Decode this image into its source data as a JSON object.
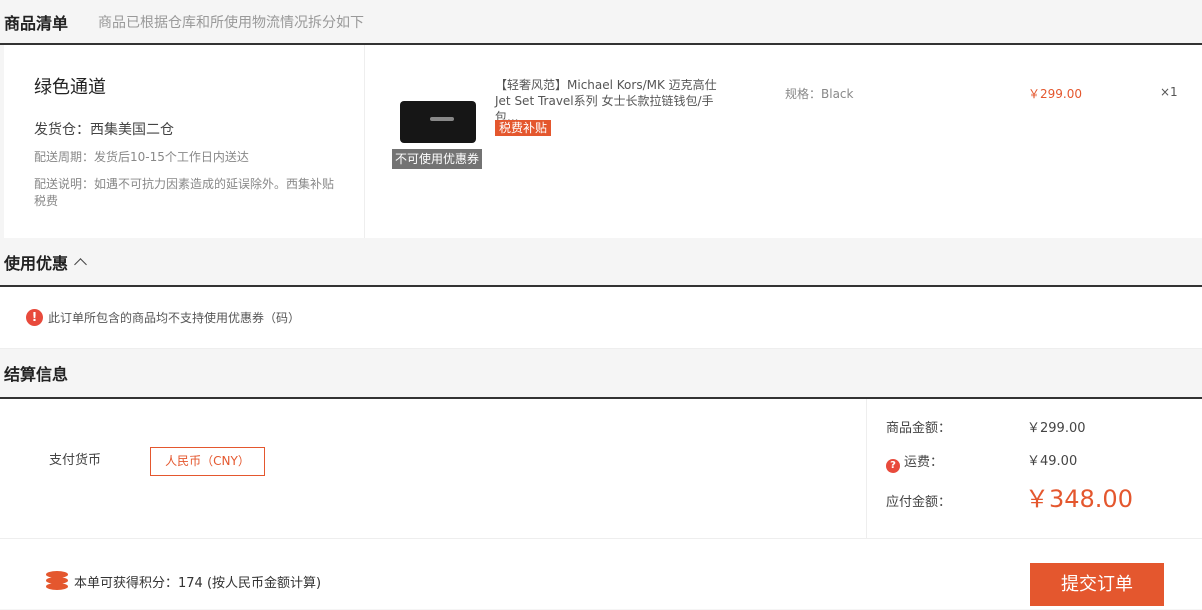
{
  "goods_list": {
    "title": "商品清单",
    "subtitle": "商品已根据仓库和所使用物流情况拆分如下",
    "channel": "绿色通道",
    "warehouse": "发货仓：西集美国二仓",
    "delivery_period": "配送周期：发货后10-15个工作日内送达",
    "delivery_note": "配送说明：如遇不可抗力因素造成的延误除外。西集补贴税费",
    "item": {
      "image_label": "不可使用优惠券",
      "name": "【轻奢风范】Michael Kors/MK 迈克高仕 Jet Set Travel系列 女士长款拉链钱包/手包...",
      "badge": "税费补贴",
      "spec": "规格：Black",
      "price": "￥299.00",
      "quantity": "×1"
    }
  },
  "coupon": {
    "title": "使用优惠",
    "message": "此订单所包含的商品均不支持使用优惠券（码）"
  },
  "settlement": {
    "title": "结算信息",
    "currency_label": "支付货币",
    "currency_value": "人民币（CNY）",
    "goods_amount_label": "商品金额：",
    "goods_amount_value": "￥299.00",
    "shipping_label": "运费：",
    "shipping_value": "￥49.00",
    "total_label": "应付金额：",
    "total_value": "￥348.00"
  },
  "footer": {
    "points_text": "本单可获得积分：174  (按人民币金额计算)",
    "submit_label": "提交订单"
  },
  "colors": {
    "accent": "#e4572e",
    "warning": "#e84a3c"
  }
}
